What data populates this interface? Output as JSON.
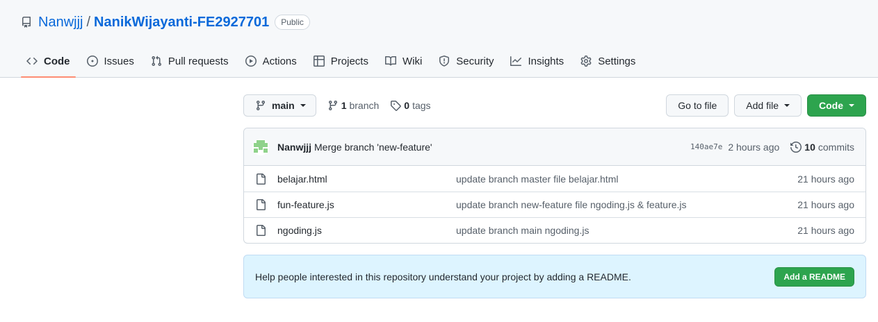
{
  "repo": {
    "owner": "Nanwjjj",
    "separator": "/",
    "name": "NanikWijayanti-FE2927701",
    "visibility": "Public"
  },
  "nav": {
    "tabs": [
      {
        "label": "Code",
        "icon": "code-icon"
      },
      {
        "label": "Issues",
        "icon": "issue-icon"
      },
      {
        "label": "Pull requests",
        "icon": "pull-request-icon"
      },
      {
        "label": "Actions",
        "icon": "play-icon"
      },
      {
        "label": "Projects",
        "icon": "table-icon"
      },
      {
        "label": "Wiki",
        "icon": "book-icon"
      },
      {
        "label": "Security",
        "icon": "shield-icon"
      },
      {
        "label": "Insights",
        "icon": "graph-icon"
      },
      {
        "label": "Settings",
        "icon": "gear-icon"
      }
    ],
    "selected": "Code"
  },
  "toolbar": {
    "branch": "main",
    "branch_count": "1",
    "branch_word": "branch",
    "tag_count": "0",
    "tag_word": "tags",
    "go_to_file": "Go to file",
    "add_file": "Add file",
    "code": "Code"
  },
  "latest_commit": {
    "author": "Nanwjjj",
    "message": "Merge branch 'new-feature'",
    "sha": "140ae7e",
    "age": "2 hours ago",
    "commit_count": "10",
    "commit_word": "commits"
  },
  "files": [
    {
      "name": "belajar.html",
      "commit": "update branch master file belajar.html",
      "age": "21 hours ago"
    },
    {
      "name": "fun-feature.js",
      "commit": "update branch new-feature file ngoding.js & feature.js",
      "age": "21 hours ago"
    },
    {
      "name": "ngoding.js",
      "commit": "update branch main ngoding.js",
      "age": "21 hours ago"
    }
  ],
  "readme": {
    "message": "Help people interested in this repository understand your project by adding a README.",
    "button": "Add a README"
  },
  "colors": {
    "accent": "#0969da",
    "green": "#2da44e",
    "tab_underline": "#fd8c73",
    "banner": "#ddf4ff"
  }
}
